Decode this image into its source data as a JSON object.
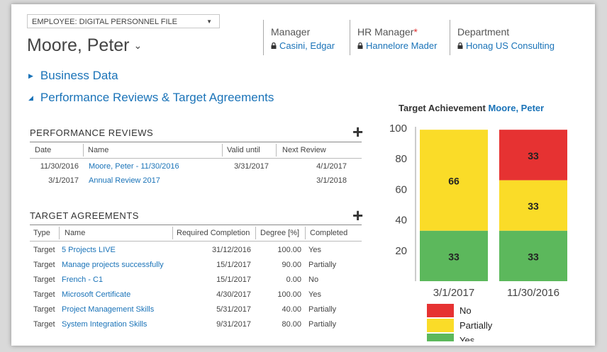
{
  "header": {
    "employee_select": "EMPLOYEE: DIGITAL PERSONNEL FILE",
    "employee_name": "Moore, Peter",
    "people": [
      {
        "label": "Manager",
        "value": "Casini, Edgar",
        "required": ""
      },
      {
        "label": "HR Manager",
        "value": "Hannelore Mader",
        "required": "*"
      },
      {
        "label": "Department",
        "value": "Honag US Consulting",
        "required": ""
      }
    ]
  },
  "sections": {
    "business_data": "Business Data",
    "performance": "Performance Reviews & Target Agreements"
  },
  "performance_reviews": {
    "title": "PERFORMANCE REVIEWS",
    "columns": [
      "Date",
      "Name",
      "Valid until",
      "Next Review"
    ],
    "rows": [
      [
        "11/30/2016",
        "Moore, Peter - 11/30/2016",
        "3/31/2017",
        "4/1/2017"
      ],
      [
        "3/1/2017",
        "Annual Review 2017",
        "",
        "3/1/2018"
      ]
    ]
  },
  "target_agreements": {
    "title": "TARGET AGREEMENTS",
    "columns": [
      "Type",
      "Name",
      "Required Completion",
      "Degree [%]",
      "Completed"
    ],
    "rows": [
      [
        "Target",
        "5 Projects LIVE",
        "31/12/2016",
        "100.00",
        "Yes"
      ],
      [
        "Target",
        "Manage projects successfully",
        "15/1/2017",
        "90.00",
        "Partially"
      ],
      [
        "Target",
        "French - C1",
        "15/1/2017",
        "0.00",
        "No"
      ],
      [
        "Target",
        "Microsoft Certificate",
        "4/30/2017",
        "100.00",
        "Yes"
      ],
      [
        "Target",
        "Project Management Skills",
        "5/31/2017",
        "40.00",
        "Partially"
      ],
      [
        "Target",
        "System Integration Skills",
        "9/31/2017",
        "80.00",
        "Partially"
      ]
    ]
  },
  "chart_data": {
    "type": "bar",
    "stacked": true,
    "title": "Target Achievement",
    "title_link": "Moore, Peter",
    "categories": [
      "3/1/2017",
      "11/30/2016"
    ],
    "series": [
      {
        "name": "Yes",
        "values": [
          33,
          33
        ],
        "color": "#5cb85c"
      },
      {
        "name": "Partially",
        "values": [
          66,
          33
        ],
        "color": "#fadc28"
      },
      {
        "name": "No",
        "values": [
          0,
          33
        ],
        "color": "#e63232"
      }
    ],
    "ylim": [
      0,
      100
    ],
    "yticks": [
      20,
      40,
      60,
      80,
      100
    ],
    "legend": "bottom"
  },
  "colors": {
    "link": "#1a73b8"
  }
}
